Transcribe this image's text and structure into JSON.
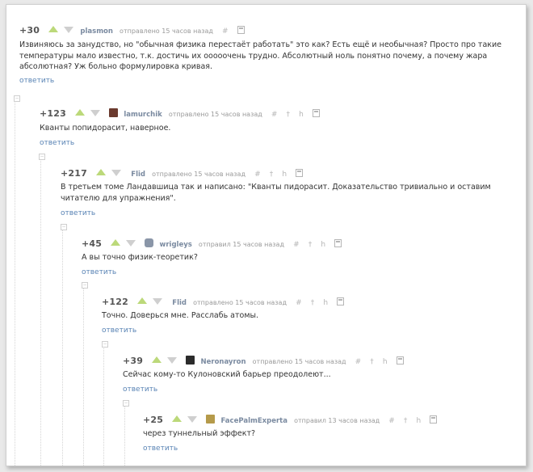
{
  "comments": [
    {
      "rating": "+30",
      "username": "plasmon",
      "time": "отправлено 15 часов назад",
      "text": "Извиняюсь за занудство, но \"обычная физика перестаёт работать\" это как? Есть ещё и необычная? Просто про такие температуры мало известно, т.к. достичь их ооооочень трудно. Абсолютный ноль понятно почему, а почему жара абсолютная? Уж больно формулировка кривая.",
      "reply": "ответить",
      "avatar_color": "",
      "actions": [
        "#"
      ]
    },
    {
      "rating": "+123",
      "username": "lamurchik",
      "time": "отправлено 15 часов назад",
      "text": "Кванты попидорасит, наверное.",
      "reply": "ответить",
      "avatar_color": "#6b3a2e",
      "actions": [
        "#",
        "†",
        "h"
      ]
    },
    {
      "rating": "+217",
      "username": "Flid",
      "time": "отправлено 15 часов назад",
      "text": "В третьем томе Ландавшица так и написано: \"Кванты пидорасит. Доказательство тривиально и оставим читателю для упражнения\".",
      "reply": "ответить",
      "avatar_color": "",
      "actions": [
        "#",
        "†",
        "h"
      ]
    },
    {
      "rating": "+45",
      "username": "wrigleys",
      "time": "отправил 15 часов назад",
      "text": "А вы точно физик-теоретик?",
      "reply": "ответить",
      "avatar_color": "#8a96a8",
      "actions": [
        "#",
        "†",
        "h"
      ]
    },
    {
      "rating": "+122",
      "username": "Flid",
      "time": "отправлено 15 часов назад",
      "text": "Точно. Доверься мне. Расслабь атомы.",
      "reply": "ответить",
      "avatar_color": "",
      "actions": [
        "#",
        "†",
        "h"
      ]
    },
    {
      "rating": "+39",
      "username": "Neronayron",
      "time": "отправлено 15 часов назад",
      "text": "Сейчас кому-то Кулоновский барьер преодолеют...",
      "reply": "ответить",
      "avatar_color": "#2b2b2b",
      "actions": [
        "#",
        "†",
        "h"
      ]
    },
    {
      "rating": "+25",
      "username": "FacePalmExperta",
      "time": "отправил 13 часов назад",
      "text": "через туннельный эффект?",
      "reply": "ответить",
      "avatar_color": "#b59a4a",
      "actions": [
        "#",
        "†",
        "h"
      ]
    }
  ],
  "collapse_symbol": "⊟",
  "colors": {
    "upvote": "#bcd97a",
    "downvote": "#cfcfcf",
    "username": "#7a8aa0",
    "reply_link": "#5a84b5",
    "text": "#333333"
  }
}
